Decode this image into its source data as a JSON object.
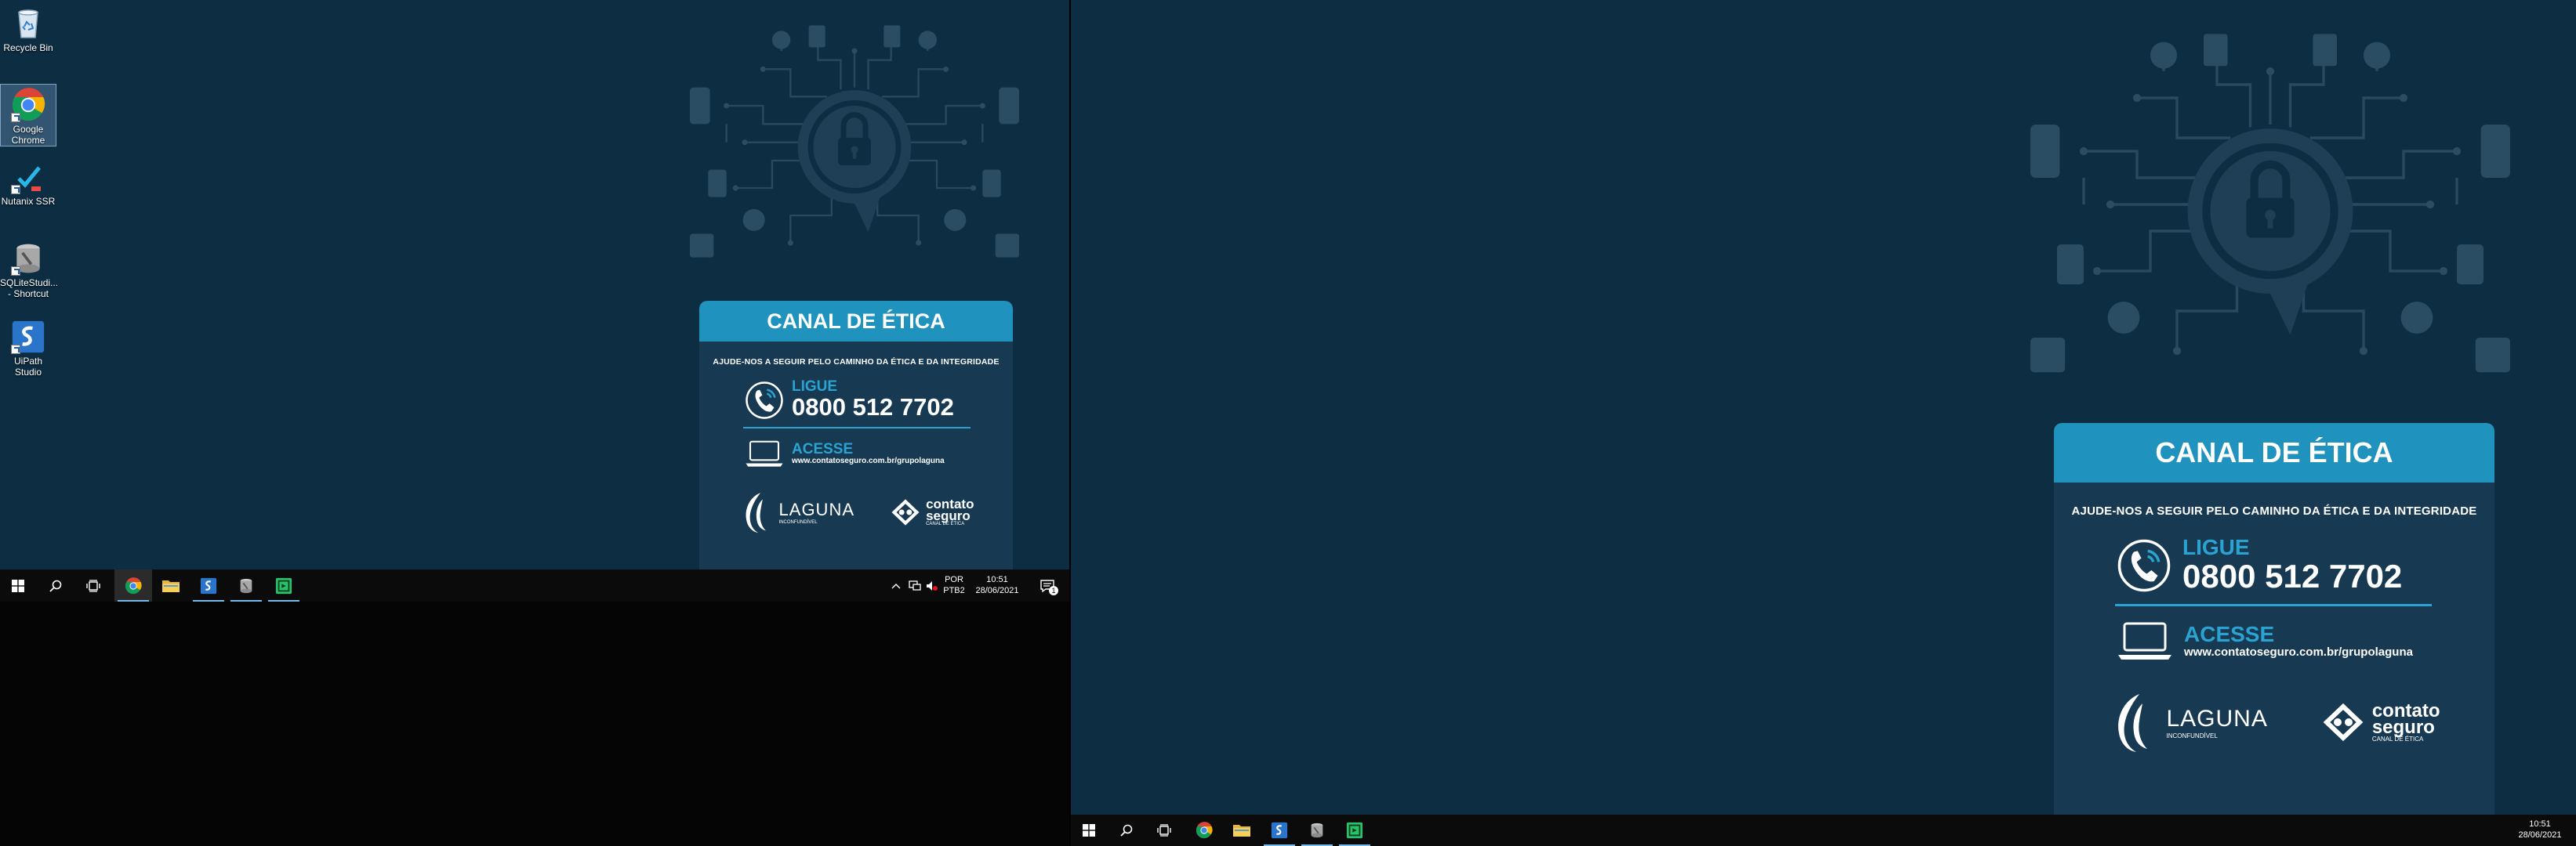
{
  "desktop_icons": [
    {
      "label": "Recycle Bin",
      "icon": "recycle-bin-icon"
    },
    {
      "label": "Google Chrome",
      "icon": "chrome-icon"
    },
    {
      "label": "Nutanix SSR",
      "icon": "nutanix-icon"
    },
    {
      "label": "SQLiteStudi... - Shortcut",
      "icon": "sqlite-icon"
    },
    {
      "label": "UiPath Studio",
      "icon": "uipath-icon"
    }
  ],
  "wallpaper": {
    "title": "CANAL DE ÉTICA",
    "subtitle": "AJUDE-NOS A SEGUIR PELO CAMINHO DA ÉTICA E DA INTEGRIDADE",
    "phone_label": "LIGUE",
    "phone_number": "0800 512 7702",
    "web_label": "ACESSE",
    "web_url": "www.contatoseguro.com.br/grupolaguna",
    "logo1_name": "LAGUNA",
    "logo1_tag": "INCONFUNDÍVEL",
    "logo2_line1": "contato",
    "logo2_line2": "seguro",
    "logo2_tag": "CANAL DE ÉTICA"
  },
  "taskbar_left": {
    "lang_line1": "POR",
    "lang_line2": "PTB2",
    "time": "10:51",
    "date": "28/06/2021",
    "notification_count": "1"
  },
  "taskbar_right": {
    "time": "10:51",
    "date": "28/06/2021"
  },
  "colors": {
    "wallpaper": "#0d2d42",
    "card": "#173a52",
    "card_header": "#1f93bd",
    "accent": "#2aa3d3",
    "taskbar": "#0b0b0c"
  }
}
